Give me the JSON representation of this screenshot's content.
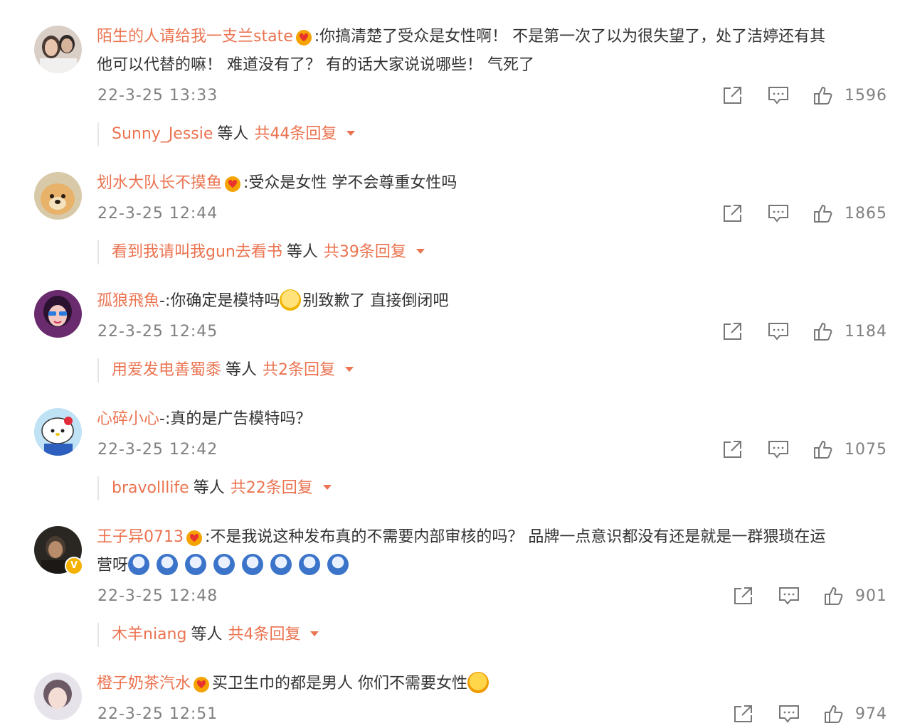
{
  "colors": {
    "accent": "#eb7350",
    "meta": "#808080",
    "text": "#333333"
  },
  "comments": [
    {
      "username": "陌生的人请给我一支兰state",
      "vip": true,
      "verified": false,
      "text_line1": ":你搞清楚了受众是女性啊！ 不是第一次了以为很失望了，处了洁婷还有其",
      "text_line2": "他可以代替的嘛！ 难道没有了？ 有的话大家说说哪些！ 气死了",
      "time": "22-3-25 13:33",
      "likes": "1596",
      "reply_user": "Sunny_Jessie",
      "reply_etc": "等人",
      "reply_count": "共44条回复"
    },
    {
      "username": "划水大队长不摸鱼",
      "vip": true,
      "verified": false,
      "text_line1": ":受众是女性 学不会尊重女性吗",
      "text_line2": "",
      "time": "22-3-25 12:44",
      "likes": "1865",
      "reply_user": "看到我请叫我gun去看书",
      "reply_etc": "等人",
      "reply_count": "共39条回复"
    },
    {
      "username": "孤狼飛魚",
      "vip": false,
      "verified": false,
      "text_line1": "-:你确定是模特吗",
      "text_line1_after_emoji": "别致歉了 直接倒闭吧",
      "emoji_inline": "grin-emoji",
      "time": "22-3-25 12:45",
      "likes": "1184",
      "reply_user": "用爱发电善蜀黍",
      "reply_etc": "等人",
      "reply_count": "共2条回复"
    },
    {
      "username": "心碎小心",
      "vip": false,
      "verified": false,
      "text_line1": "-:真的是广告模特吗？",
      "time": "22-3-25 12:42",
      "likes": "1075",
      "reply_user": "bravolllife",
      "reply_etc": "等人",
      "reply_count": "共22条回复"
    },
    {
      "username": "王子异0713",
      "vip": true,
      "verified": true,
      "text_line1": ":不是我说这种发布真的不需要内部审核的吗？ 品牌一点意识都没有还是就是一群猥琐在运",
      "text_line2": "营呀",
      "emoji_row": "doge-emoji",
      "emoji_row_count": 8,
      "time": "22-3-25 12:48",
      "likes": "901",
      "reply_user": "木羊niang",
      "reply_etc": "等人",
      "reply_count": "共4条回复"
    },
    {
      "username": "橙子奶茶汽水",
      "vip": true,
      "verified": false,
      "text_line1": "买卫生巾的都是男人 你们不需要女性",
      "emoji_inline": "rainbow-emoji",
      "time": "22-3-25 12:51",
      "likes": "974"
    }
  ]
}
